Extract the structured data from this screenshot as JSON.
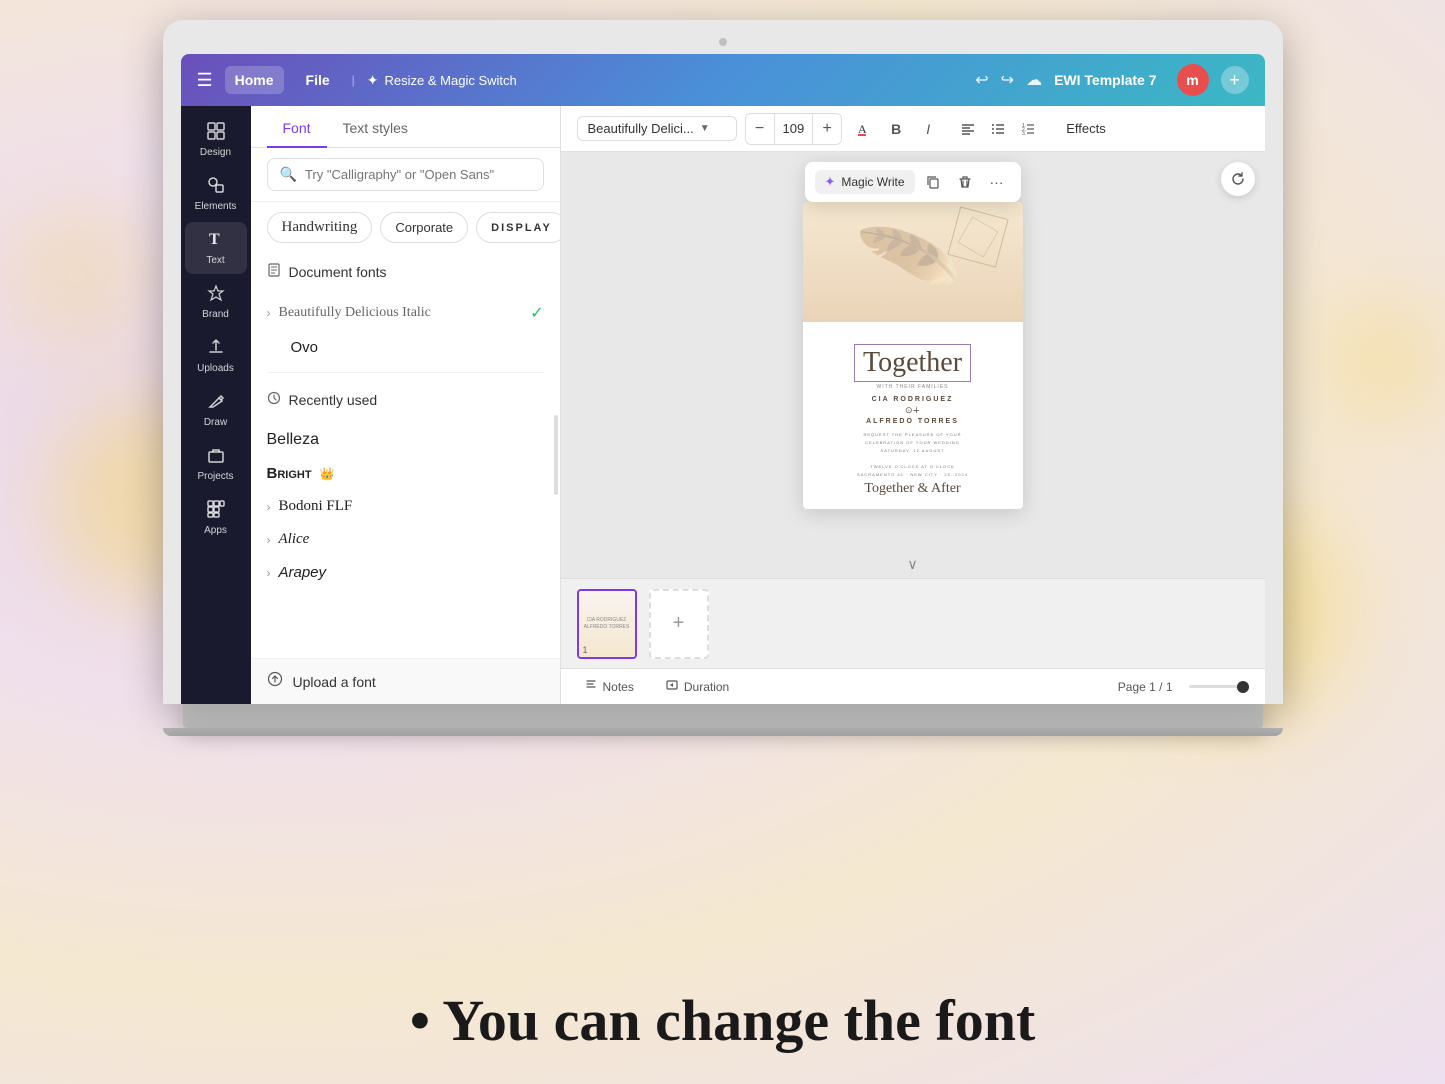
{
  "topbar": {
    "home_label": "Home",
    "file_label": "File",
    "magic_switch_label": "Resize & Magic Switch",
    "template_name": "EWI Template 7",
    "avatar_letter": "m"
  },
  "sidebar": {
    "items": [
      {
        "id": "design",
        "icon": "⊞",
        "label": "Design"
      },
      {
        "id": "elements",
        "icon": "✦",
        "label": "Elements"
      },
      {
        "id": "text",
        "icon": "T",
        "label": "Text"
      },
      {
        "id": "brand",
        "icon": "🏷",
        "label": "Brand"
      },
      {
        "id": "uploads",
        "icon": "↑",
        "label": "Uploads"
      },
      {
        "id": "draw",
        "icon": "✏",
        "label": "Draw"
      },
      {
        "id": "projects",
        "icon": "🗂",
        "label": "Projects"
      },
      {
        "id": "apps",
        "icon": "⊞",
        "label": "Apps"
      }
    ]
  },
  "font_panel": {
    "tab_font": "Font",
    "tab_text_styles": "Text styles",
    "search_placeholder": "Try \"Calligraphy\" or \"Open Sans\"",
    "categories": [
      {
        "id": "handwriting",
        "label": "Handwriting",
        "style": "handwriting"
      },
      {
        "id": "corporate",
        "label": "Corporate",
        "style": "corporate"
      },
      {
        "id": "display",
        "label": "DISPLAY",
        "style": "display"
      }
    ],
    "document_fonts_header": "Document fonts",
    "beautifully_font": "Beautifully Delicious Italic",
    "ovo_font": "Ovo",
    "recently_used_header": "Recently used",
    "fonts": [
      {
        "name": "Belleza",
        "style": "regular"
      },
      {
        "name": "Bright",
        "style": "bright",
        "crown": true
      },
      {
        "name": "Bodoni FLF",
        "style": "bodoni",
        "expandable": true
      },
      {
        "name": "Alice",
        "style": "alice",
        "expandable": true
      },
      {
        "name": "Arapey",
        "style": "arapey",
        "expandable": true
      }
    ],
    "upload_label": "Upload a font"
  },
  "toolbar": {
    "font_name": "Beautifully Delici...",
    "font_size": "109",
    "effects_label": "Effects"
  },
  "canvas": {
    "magic_write_label": "Magic Write",
    "page_label": "Page 1 / 1"
  },
  "status_bar": {
    "notes_label": "Notes",
    "duration_label": "Duration",
    "page_info": "Page 1 / 1"
  },
  "bottom_text": "• You can change the font"
}
